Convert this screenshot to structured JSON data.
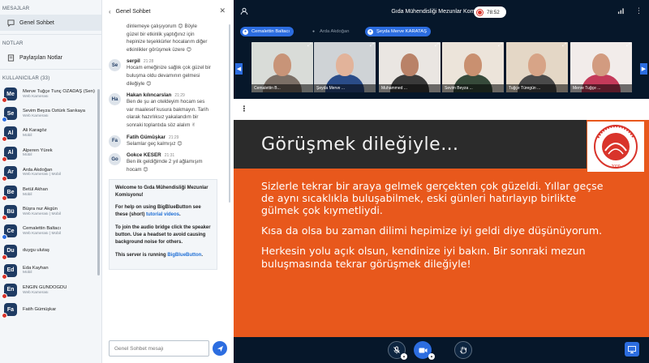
{
  "sidebar": {
    "messages_title": "MESAJLAR",
    "public_chat": "Genel Sohbet",
    "notes_title": "NOTLAR",
    "shared_notes": "Paylaşılan Notlar",
    "users_title": "KULLANICILAR (33)",
    "users": [
      {
        "initials": "Me",
        "name": "Merve Tuğçe Tunç OZADAŞ (Sen)",
        "sub": "Web Kamerası",
        "badge": "red"
      },
      {
        "initials": "Se",
        "name": "Sevim Beyza Öztürk Sarıkaya",
        "sub": "Web Kamerası",
        "badge": "blue"
      },
      {
        "initials": "Al",
        "name": "Ali Karagöz",
        "sub": "Mobil",
        "badge": "red"
      },
      {
        "initials": "Al",
        "name": "Alperen Yürek",
        "sub": "Mobil",
        "badge": "red"
      },
      {
        "initials": "Ar",
        "name": "Arda Akdoğan",
        "sub": "Web Kamerası | Mobil",
        "badge": "red"
      },
      {
        "initials": "Be",
        "name": "Betül Akhan",
        "sub": "Mobil",
        "badge": "red"
      },
      {
        "initials": "Bü",
        "name": "Büşra nur Akgün",
        "sub": "Web Kamerası | Mobil",
        "badge": "red"
      },
      {
        "initials": "Ce",
        "name": "Cemalettin Baltacı",
        "sub": "Web Kamerası | Mobil",
        "badge": "blue"
      },
      {
        "initials": "Du",
        "name": "duygu ulutaş",
        "sub": "",
        "badge": "red"
      },
      {
        "initials": "Ed",
        "name": "Eda Kayhan",
        "sub": "Mobil",
        "badge": "red"
      },
      {
        "initials": "En",
        "name": "ENGİN GÜNDOĞDU",
        "sub": "Web Kamerası",
        "badge": "red"
      },
      {
        "initials": "Fa",
        "name": "Fatih Gümüşkar",
        "sub": "",
        "badge": "red"
      }
    ]
  },
  "chat": {
    "title": "Genel Sohbet",
    "messages": [
      {
        "cont": true,
        "lines": [
          "dinlemeye çalışıyorum 😊 Böyle",
          "güzel bir etkinlik yaptığınız için",
          "hepinize teşekkürler hocalarım diğer",
          "etkinlikler görüşmek üzere 😊"
        ]
      },
      {
        "initials": "Se",
        "who": "serpil",
        "time": "21:28",
        "lines": [
          "Hocam emeğinize sağlık çok güzel bir",
          "buluşma oldu devamının gelmesi",
          "dileğiyle 😊"
        ]
      },
      {
        "initials": "Ha",
        "who": "Hakan kılıncarslan",
        "time": "21:29",
        "lines": [
          "Ben de şu an oteldeyim hocam ses",
          "var maalesef kusura bakmayın. Tarih",
          "olarak hazırlıksız yakalandım bir",
          "sonraki toplantıda söz alalım ✌"
        ]
      },
      {
        "initials": "Fa",
        "who": "Fatih Gümüşkar",
        "time": "21:29",
        "lines": [
          "Selamlar geç kalmışız 😊"
        ]
      },
      {
        "initials": "Go",
        "who": "Gokce KESER",
        "time": "21:31",
        "lines": [
          "Ben ilk geldiğimde 2 yıl ağlamışım",
          "hocam 😊"
        ]
      }
    ],
    "welcome": {
      "p1": "Welcome to Gıda Mühendisliği Mezunlar Komisyonu!",
      "p2a": "For help on using BigBlueButton see these (short) ",
      "p2link": "tutorial videos",
      "p2b": ".",
      "p3": "To join the audio bridge click the speaker button. Use a headset to avoid causing background noise for others.",
      "p4a": "This server is running ",
      "p4link": "BigBlueButton",
      "p4b": "."
    },
    "input_placeholder": "Genel Sohbet mesajı"
  },
  "main": {
    "title": "Gıda Mühendisliği Mezunlar Komisyonu",
    "rec_time": "78:52",
    "talkers": [
      {
        "name": "Cemalettin Baltacı",
        "active": true
      },
      {
        "name": "Arda Akdoğan",
        "active": false
      },
      {
        "name": "Şeyda Merve KARATAŞ",
        "active": true
      }
    ],
    "videos": [
      {
        "name": "Cemalettin B...",
        "skin": "#c89478",
        "shirt": "#7b6f66",
        "bg": "#d9dcd8"
      },
      {
        "name": "Şeyda Merve ...",
        "skin": "#e2b39a",
        "shirt": "#2a4c89",
        "bg": "#cfd3d6"
      },
      {
        "name": "Muhammed ...",
        "skin": "#b98268",
        "shirt": "#3a3a3a",
        "bg": "#eae6e2"
      },
      {
        "name": "Sevim Beyza ...",
        "skin": "#c99070",
        "shirt": "#364a3a",
        "bg": "#ece4da"
      },
      {
        "name": "Tuğçe Türegün ...",
        "skin": "#d7a487",
        "shirt": "#4a4a4a",
        "bg": "#e4d7c6"
      },
      {
        "name": "Merve Tuğçe ...",
        "skin": "#d29b80",
        "shirt": "#c43a5a",
        "bg": "#f2ecea"
      }
    ],
    "slide": {
      "title": "Görüşmek dileğiyle…",
      "paragraphs": [
        "Sizlerle tekrar bir araya gelmek gerçekten çok güzeldi. Yıllar geçse de aynı sıcaklıkla buluşabilmek, eski günleri hatırlayıp birlikte gülmek çok kıymetliydi.",
        "Kısa da olsa bu zaman dilimi hepimize iyi geldi diye düşünüyorum.",
        "Herkesin yolu açık olsun, kendinize iyi bakın. Bir sonraki mezun buluşmasında tekrar görüşmek dileğiyle!"
      ],
      "logo_year": "2000"
    }
  },
  "colors": {
    "accent": "#2c6de0",
    "record": "#d9342b",
    "slide_bg": "#e8581c",
    "dark_bg": "#06172a"
  }
}
